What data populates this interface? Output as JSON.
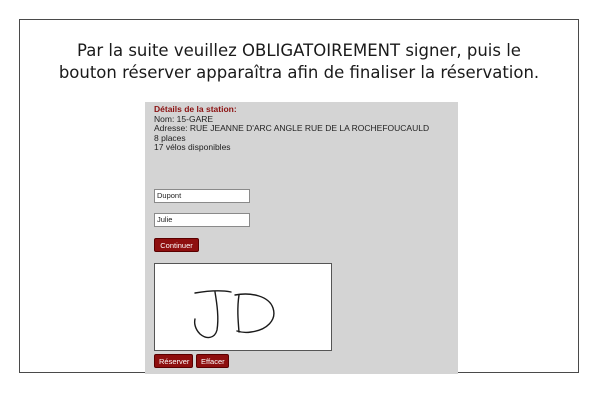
{
  "instruction": {
    "line1": "Par la suite veuillez OBLIGATOIREMENT signer, puis le",
    "line2": "bouton réserver apparaîtra afin de finaliser la réservation."
  },
  "station": {
    "heading": "Détails de la station:",
    "name": "Nom: 15-GARE",
    "address": "Adresse: RUE JEANNE D'ARC ANGLE RUE DE LA ROCHEFOUCAULD",
    "places": "8 places",
    "bikes": "17 vélos disponibles"
  },
  "form": {
    "last_name_value": "Dupont",
    "first_name_value": "Julie",
    "continue_label": "Continuer"
  },
  "signature": {
    "stroke_color": "#1a1a1a",
    "content": "JD"
  },
  "actions": {
    "reserve_label": "Réserver",
    "clear_label": "Effacer"
  },
  "colors": {
    "accent": "#8e0f0f",
    "panel_bg": "#d4d4d4"
  }
}
